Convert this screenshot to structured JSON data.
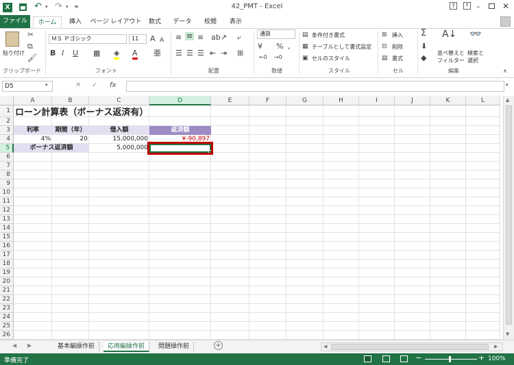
{
  "window": {
    "title": "42_PMT - Excel",
    "help": "?"
  },
  "qat": {
    "save_icon": "save-icon",
    "undo_icon": "undo-icon",
    "redo_icon": "redo-icon"
  },
  "tabs": [
    "ファイル",
    "ホーム",
    "挿入",
    "ページ レイアウト",
    "数式",
    "データ",
    "校閲",
    "表示"
  ],
  "ribbon": {
    "clipboard": {
      "paste": "貼り付け",
      "label": "クリップボード"
    },
    "font": {
      "name": "ＭＳ Ｐゴシック",
      "size": "11",
      "label": "フォント"
    },
    "alignment": {
      "label": "配置"
    },
    "number": {
      "format": "通貨",
      "label": "数値"
    },
    "styles": {
      "conditional": "条件付き書式",
      "table": "テーブルとして書式設定",
      "cell_styles": "セルのスタイル",
      "label": "スタイル"
    },
    "cells": {
      "insert": "挿入",
      "delete": "削除",
      "format": "書式",
      "label": "セル"
    },
    "editing": {
      "sort": "並べ替えと",
      "filter": "フィルター",
      "find": "検索と",
      "select": "選択",
      "label": "編集"
    }
  },
  "formula_bar": {
    "name_box": "D5",
    "fx": "fx",
    "value": ""
  },
  "columns": [
    "A",
    "B",
    "C",
    "D",
    "E",
    "F",
    "G",
    "H",
    "I",
    "J",
    "K",
    "L"
  ],
  "rows": [
    "1",
    "2",
    "3",
    "4",
    "5",
    "6",
    "7",
    "8",
    "9",
    "10",
    "11",
    "12",
    "13",
    "14",
    "15",
    "16",
    "17",
    "18",
    "19",
    "20",
    "21",
    "22",
    "23",
    "24",
    "25",
    "26"
  ],
  "cells": {
    "a1": "ローン計算表（ボーナス返済有）",
    "a3": "利率",
    "b3": "期間（年）",
    "c3": "借入額",
    "d3": "返済額",
    "a4": "4%",
    "b4": "20",
    "c4": "15,000,000",
    "d4": "¥-90,897",
    "a5": "ボーナス返済額",
    "c5": "5,000,000"
  },
  "sheets": [
    "基本編操作前",
    "応用編操作前",
    "問題操作前"
  ],
  "active_sheet": "応用編操作前",
  "status": {
    "text": "準備完了",
    "zoom": "100%"
  },
  "colors": {
    "excel_green": "#217346",
    "header_fill": "#e4dff0",
    "header_fill_dark": "#9c8bc4",
    "highlight_border": "#c00000",
    "negative": "#c00000"
  }
}
